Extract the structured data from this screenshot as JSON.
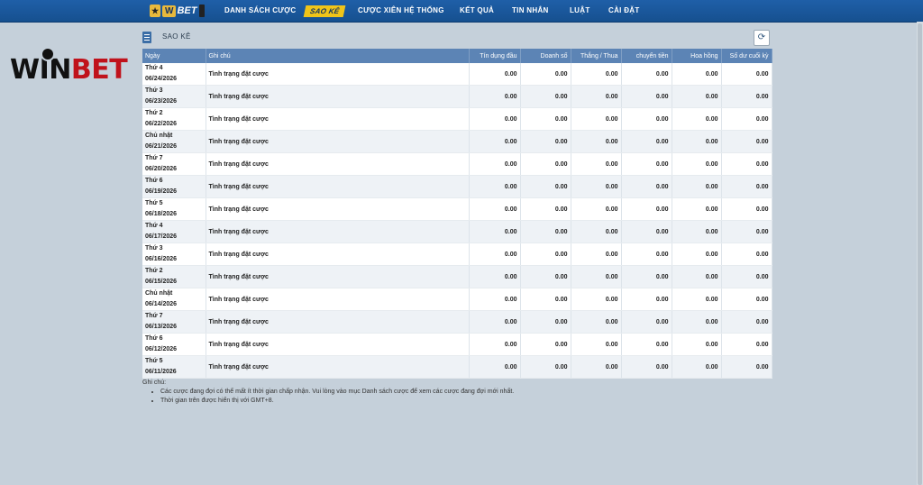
{
  "nav": {
    "brand_text": "WBET",
    "items": [
      {
        "label": "DANH SÁCH CƯỢC",
        "active": false
      },
      {
        "label": "SAO KÊ",
        "active": true
      },
      {
        "label": "CƯỢC XIÊN HỆ THỐNG",
        "active": false
      },
      {
        "label": "KẾT QUẢ",
        "active": false
      },
      {
        "label": "TIN NHẮN",
        "active": false
      },
      {
        "label": "LUẬT",
        "active": false
      },
      {
        "label": "CÀI ĐẶT",
        "active": false
      }
    ]
  },
  "logo": {
    "text_dark": "WIN",
    "text_red": "BET"
  },
  "section": {
    "title": "SAO KÊ",
    "refresh_icon": "refresh-icon"
  },
  "table": {
    "headers": [
      "Ngày",
      "Ghi chú",
      "Tín dụng đầu",
      "Doanh số",
      "Thắng / Thua",
      "chuyển tiền",
      "Hoa hồng",
      "Số dư cuối kỳ"
    ],
    "rows": [
      {
        "day": "Thứ 4",
        "date": "06/24/2026",
        "note": "Tình trạng đặt cược",
        "credit": "0.00",
        "turnover": "0.00",
        "winloss": "0.00",
        "transfer": "0.00",
        "commission": "0.00",
        "balance": "0.00"
      },
      {
        "day": "Thứ 3",
        "date": "06/23/2026",
        "note": "Tình trạng đặt cược",
        "credit": "0.00",
        "turnover": "0.00",
        "winloss": "0.00",
        "transfer": "0.00",
        "commission": "0.00",
        "balance": "0.00"
      },
      {
        "day": "Thứ 2",
        "date": "06/22/2026",
        "note": "Tình trạng đặt cược",
        "credit": "0.00",
        "turnover": "0.00",
        "winloss": "0.00",
        "transfer": "0.00",
        "commission": "0.00",
        "balance": "0.00"
      },
      {
        "day": "Chủ nhật",
        "date": "06/21/2026",
        "note": "Tình trạng đặt cược",
        "credit": "0.00",
        "turnover": "0.00",
        "winloss": "0.00",
        "transfer": "0.00",
        "commission": "0.00",
        "balance": "0.00"
      },
      {
        "day": "Thứ 7",
        "date": "06/20/2026",
        "note": "Tình trạng đặt cược",
        "credit": "0.00",
        "turnover": "0.00",
        "winloss": "0.00",
        "transfer": "0.00",
        "commission": "0.00",
        "balance": "0.00"
      },
      {
        "day": "Thứ 6",
        "date": "06/19/2026",
        "note": "Tình trạng đặt cược",
        "credit": "0.00",
        "turnover": "0.00",
        "winloss": "0.00",
        "transfer": "0.00",
        "commission": "0.00",
        "balance": "0.00"
      },
      {
        "day": "Thứ 5",
        "date": "06/18/2026",
        "note": "Tình trạng đặt cược",
        "credit": "0.00",
        "turnover": "0.00",
        "winloss": "0.00",
        "transfer": "0.00",
        "commission": "0.00",
        "balance": "0.00"
      },
      {
        "day": "Thứ 4",
        "date": "06/17/2026",
        "note": "Tình trạng đặt cược",
        "credit": "0.00",
        "turnover": "0.00",
        "winloss": "0.00",
        "transfer": "0.00",
        "commission": "0.00",
        "balance": "0.00"
      },
      {
        "day": "Thứ 3",
        "date": "06/16/2026",
        "note": "Tình trạng đặt cược",
        "credit": "0.00",
        "turnover": "0.00",
        "winloss": "0.00",
        "transfer": "0.00",
        "commission": "0.00",
        "balance": "0.00"
      },
      {
        "day": "Thứ 2",
        "date": "06/15/2026",
        "note": "Tình trạng đặt cược",
        "credit": "0.00",
        "turnover": "0.00",
        "winloss": "0.00",
        "transfer": "0.00",
        "commission": "0.00",
        "balance": "0.00"
      },
      {
        "day": "Chủ nhật",
        "date": "06/14/2026",
        "note": "Tình trạng đặt cược",
        "credit": "0.00",
        "turnover": "0.00",
        "winloss": "0.00",
        "transfer": "0.00",
        "commission": "0.00",
        "balance": "0.00"
      },
      {
        "day": "Thứ 7",
        "date": "06/13/2026",
        "note": "Tình trạng đặt cược",
        "credit": "0.00",
        "turnover": "0.00",
        "winloss": "0.00",
        "transfer": "0.00",
        "commission": "0.00",
        "balance": "0.00"
      },
      {
        "day": "Thứ 6",
        "date": "06/12/2026",
        "note": "Tình trạng đặt cược",
        "credit": "0.00",
        "turnover": "0.00",
        "winloss": "0.00",
        "transfer": "0.00",
        "commission": "0.00",
        "balance": "0.00"
      },
      {
        "day": "Thứ 5",
        "date": "06/11/2026",
        "note": "Tình trạng đặt cược",
        "credit": "0.00",
        "turnover": "0.00",
        "winloss": "0.00",
        "transfer": "0.00",
        "commission": "0.00",
        "balance": "0.00"
      }
    ]
  },
  "notes": {
    "title": "Ghi chú:",
    "items": [
      "Các cược đang đợi có thể mất ít thời gian chấp nhận. Vui lòng vào mục Danh sách cược để xem các cược đang đợi mới nhất.",
      "Thời gian trên được hiển thị với GMT+8."
    ]
  }
}
